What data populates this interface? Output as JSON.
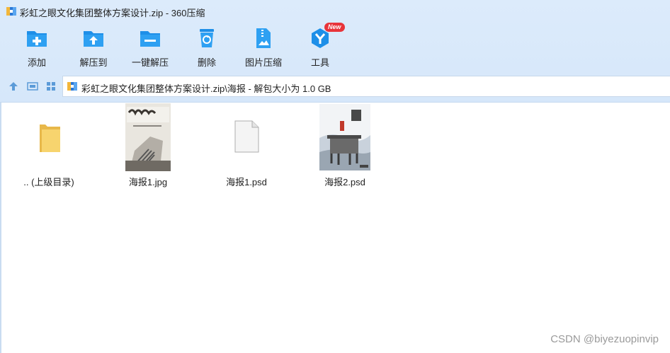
{
  "window": {
    "title": "彩虹之眼文化集团整体方案设计.zip - 360压缩"
  },
  "toolbar": {
    "items": [
      {
        "label": "添加",
        "icon": "add-folder-icon"
      },
      {
        "label": "解压到",
        "icon": "extract-to-icon"
      },
      {
        "label": "一键解压",
        "icon": "one-click-extract-icon"
      },
      {
        "label": "删除",
        "icon": "trash-icon"
      },
      {
        "label": "图片压缩",
        "icon": "image-compress-icon"
      },
      {
        "label": "工具",
        "icon": "tools-icon",
        "badge": "New"
      }
    ]
  },
  "navbar": {
    "path": "彩虹之眼文化集团整体方案设计.zip\\海报 - 解包大小为 1.0 GB"
  },
  "files": [
    {
      "name": ".. (上级目录)",
      "type": "parent-folder"
    },
    {
      "name": "海报1.jpg",
      "type": "image"
    },
    {
      "name": "海报1.psd",
      "type": "document"
    },
    {
      "name": "海报2.psd",
      "type": "image"
    }
  ],
  "watermark": "CSDN @biyezuopinvip",
  "colors": {
    "accent": "#1e90ea",
    "toolbar_bg": "#d8e9fb",
    "badge": "#e8343a"
  }
}
